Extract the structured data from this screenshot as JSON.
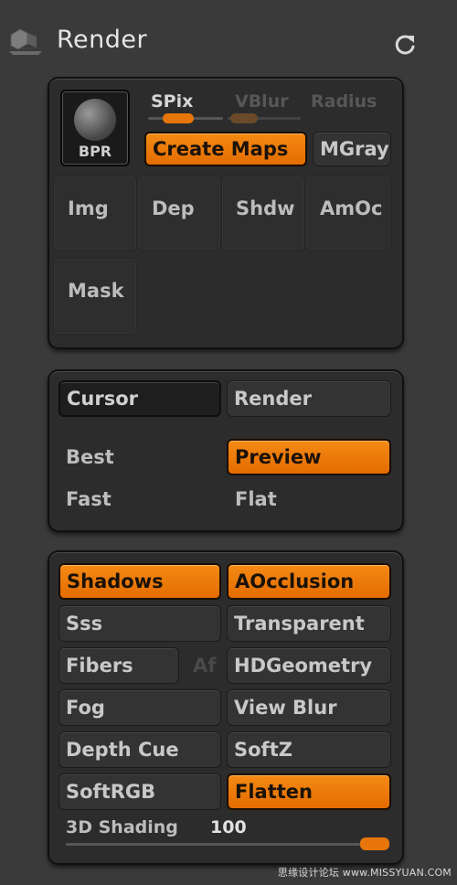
{
  "header": {
    "title": "Render",
    "icon": "render-teapot-icon",
    "action_icon": "refresh-icon"
  },
  "bpr_panel": {
    "bpr_label": "BPR",
    "sliders": [
      "SPix",
      "VBlur",
      "Radius"
    ],
    "create_maps": "Create Maps",
    "mgray": "MGray",
    "cells": [
      "Img",
      "Dep",
      "Shdw",
      "AmOc",
      "Mask"
    ]
  },
  "mode_panel": {
    "cursor": "Cursor",
    "render": "Render",
    "best": "Best",
    "preview": "Preview",
    "fast": "Fast",
    "flat": "Flat"
  },
  "options_panel": {
    "shadows": "Shadows",
    "aocclusion": "AOcclusion",
    "sss": "Sss",
    "transparent": "Transparent",
    "fibers": "Fibers",
    "af": "Af",
    "hdgeometry": "HDGeometry",
    "fog": "Fog",
    "view_blur": "View Blur",
    "depth_cue": "Depth Cue",
    "softz": "SoftZ",
    "softrgb": "SoftRGB",
    "flatten": "Flatten",
    "shading_label": "3D Shading",
    "shading_value": "100"
  },
  "watermark": "思缘设计论坛 www.MISSYUAN.COM",
  "colors": {
    "accent": "#e8750a",
    "panel": "#2c2c2c",
    "background": "#3a3a3a"
  }
}
